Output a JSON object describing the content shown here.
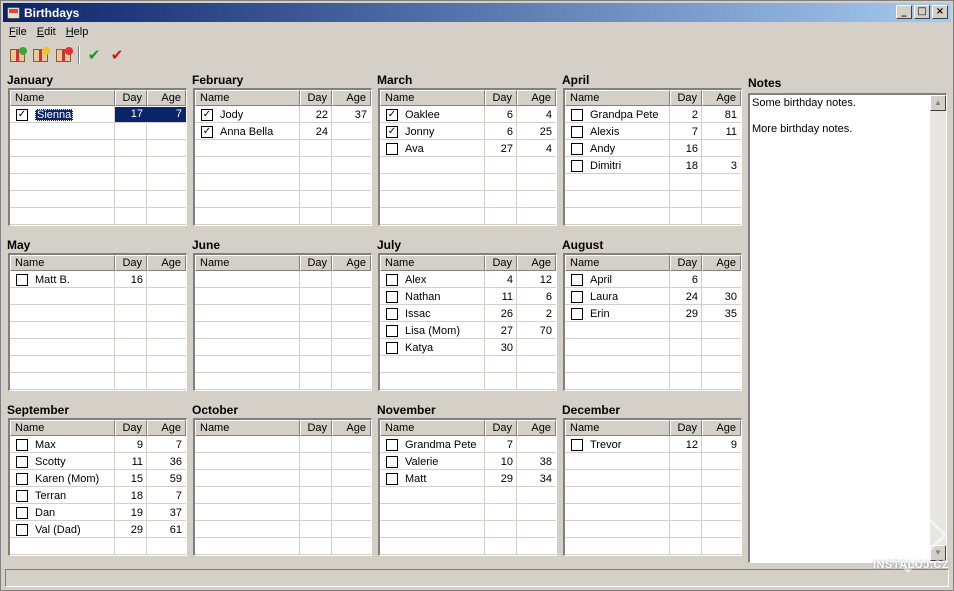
{
  "window": {
    "title": "Birthdays"
  },
  "menu": {
    "items": [
      "File",
      "Edit",
      "Help"
    ]
  },
  "toolbar": {
    "tools": [
      "add-birthday-icon",
      "edit-birthday-icon",
      "delete-birthday-icon",
      "check-green-icon",
      "check-red-icon"
    ]
  },
  "columns": {
    "name": "Name",
    "day": "Day",
    "age": "Age"
  },
  "months": [
    {
      "name": "January",
      "rows": [
        {
          "name": "Sienna",
          "day": "17",
          "age": "7",
          "checked": true,
          "selected": true
        }
      ]
    },
    {
      "name": "February",
      "rows": [
        {
          "name": "Jody",
          "day": "22",
          "age": "37",
          "checked": true
        },
        {
          "name": "Anna Bella",
          "day": "24",
          "age": "",
          "checked": true
        }
      ]
    },
    {
      "name": "March",
      "rows": [
        {
          "name": "Oaklee",
          "day": "6",
          "age": "4",
          "checked": true
        },
        {
          "name": "Jonny",
          "day": "6",
          "age": "25",
          "checked": true
        },
        {
          "name": "Ava",
          "day": "27",
          "age": "4",
          "checked": false
        }
      ]
    },
    {
      "name": "April",
      "rows": [
        {
          "name": "Grandpa Pete",
          "day": "2",
          "age": "81",
          "checked": false
        },
        {
          "name": "Alexis",
          "day": "7",
          "age": "11",
          "checked": false
        },
        {
          "name": "Andy",
          "day": "16",
          "age": "",
          "checked": false
        },
        {
          "name": "Dimitri",
          "day": "18",
          "age": "3",
          "checked": false
        }
      ]
    },
    {
      "name": "May",
      "rows": [
        {
          "name": "Matt B.",
          "day": "16",
          "age": "",
          "checked": false
        }
      ]
    },
    {
      "name": "June",
      "rows": []
    },
    {
      "name": "July",
      "rows": [
        {
          "name": "Alex",
          "day": "4",
          "age": "12",
          "checked": false
        },
        {
          "name": "Nathan",
          "day": "11",
          "age": "6",
          "checked": false
        },
        {
          "name": "Issac",
          "day": "26",
          "age": "2",
          "checked": false
        },
        {
          "name": "Lisa (Mom)",
          "day": "27",
          "age": "70",
          "checked": false
        },
        {
          "name": "Katya",
          "day": "30",
          "age": "",
          "checked": false
        }
      ]
    },
    {
      "name": "August",
      "rows": [
        {
          "name": "April",
          "day": "6",
          "age": "",
          "checked": false
        },
        {
          "name": "Laura",
          "day": "24",
          "age": "30",
          "checked": false
        },
        {
          "name": "Erin",
          "day": "29",
          "age": "35",
          "checked": false
        }
      ]
    },
    {
      "name": "September",
      "rows": [
        {
          "name": "Max",
          "day": "9",
          "age": "7",
          "checked": false
        },
        {
          "name": "Scotty",
          "day": "11",
          "age": "36",
          "checked": false
        },
        {
          "name": "Karen (Mom)",
          "day": "15",
          "age": "59",
          "checked": false
        },
        {
          "name": "Terran",
          "day": "18",
          "age": "7",
          "checked": false
        },
        {
          "name": "Dan",
          "day": "19",
          "age": "37",
          "checked": false
        },
        {
          "name": "Val (Dad)",
          "day": "29",
          "age": "61",
          "checked": false
        }
      ]
    },
    {
      "name": "October",
      "rows": []
    },
    {
      "name": "November",
      "rows": [
        {
          "name": "Grandma Pete",
          "day": "7",
          "age": "",
          "checked": false
        },
        {
          "name": "Valerie",
          "day": "10",
          "age": "38",
          "checked": false
        },
        {
          "name": "Matt",
          "day": "29",
          "age": "34",
          "checked": false
        }
      ]
    },
    {
      "name": "December",
      "rows": [
        {
          "name": "Trevor",
          "day": "12",
          "age": "9",
          "checked": false
        }
      ]
    }
  ],
  "notes": {
    "title": "Notes",
    "lines": [
      "Some birthday notes.",
      "More birthday notes."
    ]
  },
  "watermark": {
    "text": "INSTALUJ.CZ"
  }
}
